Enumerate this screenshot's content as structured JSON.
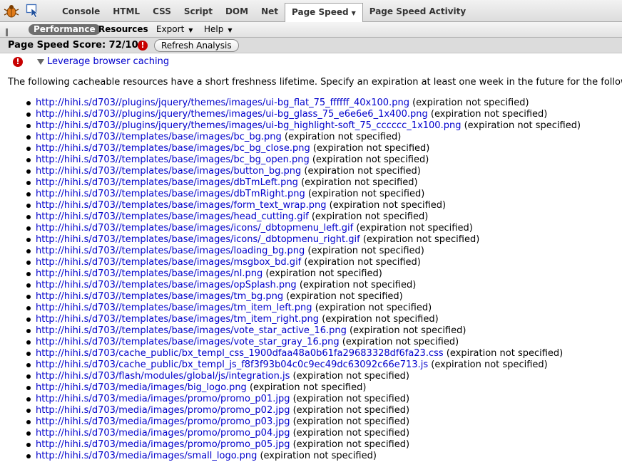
{
  "toolbar": {
    "tabs": [
      "Console",
      "HTML",
      "CSS",
      "Script",
      "DOM",
      "Net",
      "Page Speed",
      "Page Speed Activity"
    ],
    "active_tab": "Page Speed",
    "icons": [
      "firebug-icon",
      "inspect-icon"
    ]
  },
  "subtoolbar": {
    "performance": "Performance",
    "resources": "Resources",
    "export": "Export",
    "help": "Help"
  },
  "scorebar": {
    "score": "Page Speed Score: 72/100",
    "refresh": "Refresh Analysis"
  },
  "rule": {
    "title": "Leverage browser caching",
    "intro": "The following cacheable resources have a short freshness lifetime. Specify an expiration at least one week in the future for the following"
  },
  "resources": [
    {
      "url": "http://hihi.s/d703//plugins/jquery/themes/images/ui-bg_flat_75_ffffff_40x100.png",
      "note": "(expiration not specified)"
    },
    {
      "url": "http://hihi.s/d703//plugins/jquery/themes/images/ui-bg_glass_75_e6e6e6_1x400.png",
      "note": "(expiration not specified)"
    },
    {
      "url": "http://hihi.s/d703//plugins/jquery/themes/images/ui-bg_highlight-soft_75_cccccc_1x100.png",
      "note": "(expiration not specified)"
    },
    {
      "url": "http://hihi.s/d703//templates/base/images/bc_bg.png",
      "note": "(expiration not specified)"
    },
    {
      "url": "http://hihi.s/d703//templates/base/images/bc_bg_close.png",
      "note": "(expiration not specified)"
    },
    {
      "url": "http://hihi.s/d703//templates/base/images/bc_bg_open.png",
      "note": "(expiration not specified)"
    },
    {
      "url": "http://hihi.s/d703//templates/base/images/button_bg.png",
      "note": "(expiration not specified)"
    },
    {
      "url": "http://hihi.s/d703//templates/base/images/dbTmLeft.png",
      "note": "(expiration not specified)"
    },
    {
      "url": "http://hihi.s/d703//templates/base/images/dbTmRight.png",
      "note": "(expiration not specified)"
    },
    {
      "url": "http://hihi.s/d703//templates/base/images/form_text_wrap.png",
      "note": "(expiration not specified)"
    },
    {
      "url": "http://hihi.s/d703//templates/base/images/head_cutting.gif",
      "note": "(expiration not specified)"
    },
    {
      "url": "http://hihi.s/d703//templates/base/images/icons/_dbtopmenu_left.gif",
      "note": "(expiration not specified)"
    },
    {
      "url": "http://hihi.s/d703//templates/base/images/icons/_dbtopmenu_right.gif",
      "note": "(expiration not specified)"
    },
    {
      "url": "http://hihi.s/d703//templates/base/images/loading_bg.png",
      "note": "(expiration not specified)"
    },
    {
      "url": "http://hihi.s/d703//templates/base/images/msgbox_bd.gif",
      "note": "(expiration not specified)"
    },
    {
      "url": "http://hihi.s/d703//templates/base/images/nl.png",
      "note": "(expiration not specified)"
    },
    {
      "url": "http://hihi.s/d703//templates/base/images/opSplash.png",
      "note": "(expiration not specified)"
    },
    {
      "url": "http://hihi.s/d703//templates/base/images/tm_bg.png",
      "note": "(expiration not specified)"
    },
    {
      "url": "http://hihi.s/d703//templates/base/images/tm_item_left.png",
      "note": "(expiration not specified)"
    },
    {
      "url": "http://hihi.s/d703//templates/base/images/tm_item_right.png",
      "note": "(expiration not specified)"
    },
    {
      "url": "http://hihi.s/d703//templates/base/images/vote_star_active_16.png",
      "note": "(expiration not specified)"
    },
    {
      "url": "http://hihi.s/d703//templates/base/images/vote_star_gray_16.png",
      "note": "(expiration not specified)"
    },
    {
      "url": "http://hihi.s/d703/cache_public/bx_templ_css_1900dfaa48a0b61fa29683328df6fa23.css",
      "note": "(expiration not specified)"
    },
    {
      "url": "http://hihi.s/d703/cache_public/bx_templ_js_f8f3f93b04c0c9ec49dc63092c66e713.js",
      "note": "(expiration not specified)"
    },
    {
      "url": "http://hihi.s/d703/flash/modules/global/js/integration.js",
      "note": "(expiration not specified)"
    },
    {
      "url": "http://hihi.s/d703/media/images/big_logo.png",
      "note": "(expiration not specified)"
    },
    {
      "url": "http://hihi.s/d703/media/images/promo/promo_p01.jpg",
      "note": "(expiration not specified)"
    },
    {
      "url": "http://hihi.s/d703/media/images/promo/promo_p02.jpg",
      "note": "(expiration not specified)"
    },
    {
      "url": "http://hihi.s/d703/media/images/promo/promo_p03.jpg",
      "note": "(expiration not specified)"
    },
    {
      "url": "http://hihi.s/d703/media/images/promo/promo_p04.jpg",
      "note": "(expiration not specified)"
    },
    {
      "url": "http://hihi.s/d703/media/images/promo/promo_p05.jpg",
      "note": "(expiration not specified)"
    },
    {
      "url": "http://hihi.s/d703/media/images/small_logo.png",
      "note": "(expiration not specified)"
    }
  ]
}
